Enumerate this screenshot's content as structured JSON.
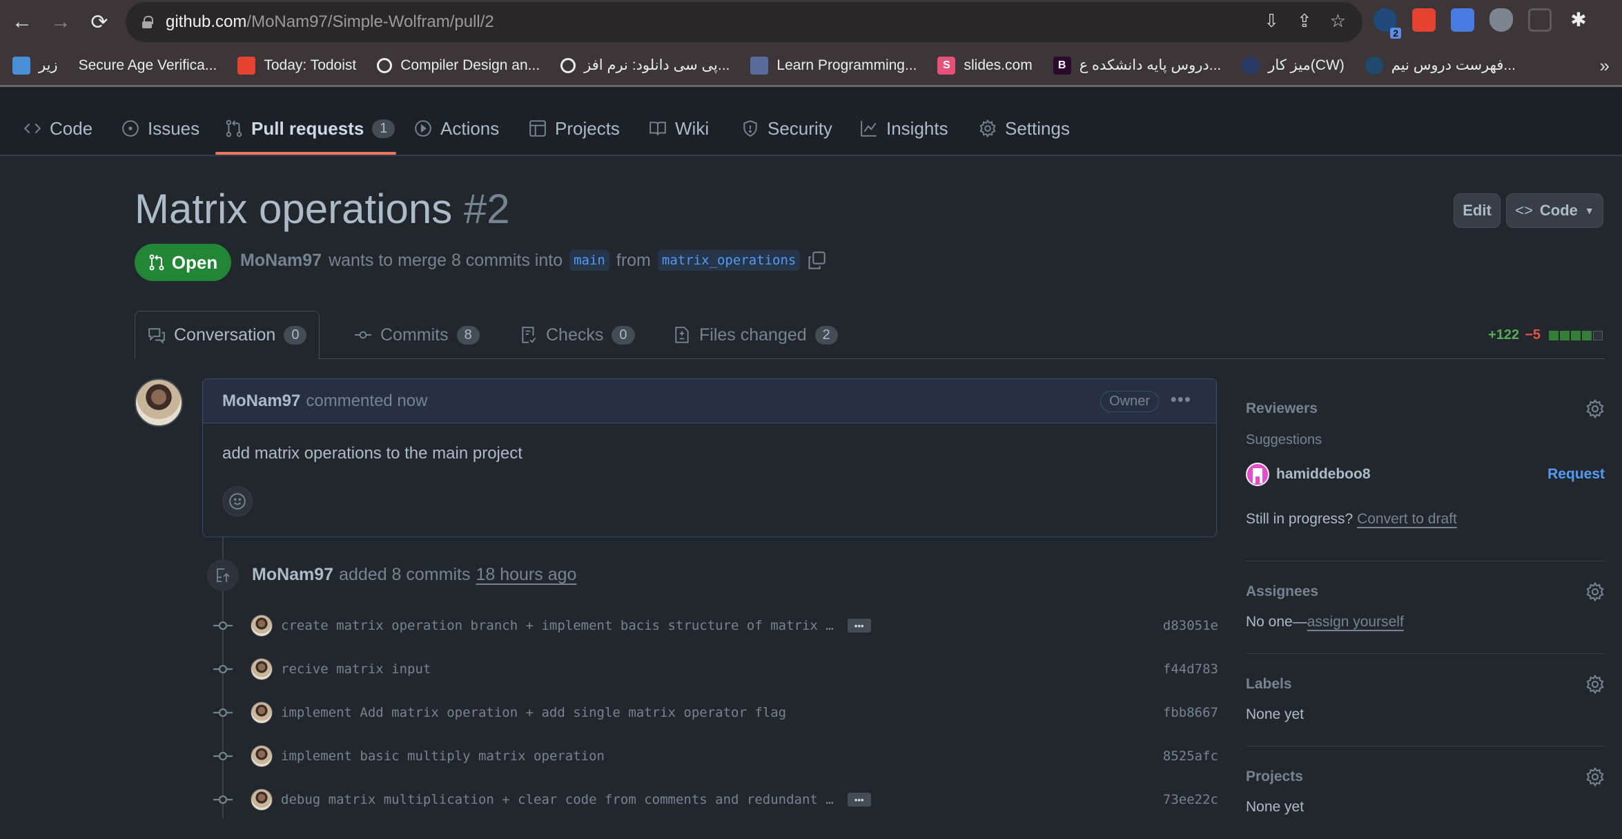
{
  "browser": {
    "url_host": "github.com",
    "url_path": "/MoNam97/Simple-Wolfram/pull/2",
    "extension_badge": "2",
    "bookmarks": [
      {
        "label": "زیر",
        "icon": "download-icon",
        "color": "#4a90d9"
      },
      {
        "label": "Secure Age Verifica...",
        "icon": "",
        "color": ""
      },
      {
        "label": "Today: Todoist",
        "icon": "todoist-icon",
        "color": "#e44332"
      },
      {
        "label": "Compiler Design an...",
        "icon": "globe-icon",
        "color": "#ececec"
      },
      {
        "label": "پی سی دانلود: نرم افز...",
        "icon": "globe-icon",
        "color": "#ececec"
      },
      {
        "label": "Learn Programming...",
        "icon": "learn-icon",
        "color": "#5a6a9a"
      },
      {
        "label": "slides.com",
        "icon": "slides-icon",
        "color": "#e4527a"
      },
      {
        "label": "دروس پایه دانشکده ع...",
        "icon": "b-icon",
        "color": "#2b0a2e"
      },
      {
        "label": "میز کار(CW)",
        "icon": "cw-icon",
        "color": "#2a3a66"
      },
      {
        "label": "فهرست دروس نیم...",
        "icon": "cw-icon",
        "color": "#1e4a6e"
      }
    ],
    "more_label": "»"
  },
  "repo_nav": {
    "tabs": [
      {
        "label": "Code",
        "icon": "code-icon"
      },
      {
        "label": "Issues",
        "icon": "issue-icon"
      },
      {
        "label": "Pull requests",
        "icon": "pull-request-icon",
        "count": "1",
        "active": true
      },
      {
        "label": "Actions",
        "icon": "play-icon"
      },
      {
        "label": "Projects",
        "icon": "table-icon"
      },
      {
        "label": "Wiki",
        "icon": "book-icon"
      },
      {
        "label": "Security",
        "icon": "shield-icon"
      },
      {
        "label": "Insights",
        "icon": "graph-icon"
      },
      {
        "label": "Settings",
        "icon": "gear-icon"
      }
    ]
  },
  "pr": {
    "title": "Matrix operations",
    "number": "#2",
    "edit_label": "Edit",
    "code_label": "Code",
    "state": "Open",
    "author": "MoNam97",
    "merge_text": "wants to merge 8 commits into",
    "base_branch": "main",
    "from_text": "from",
    "head_branch": "matrix_operations"
  },
  "pr_tabs": [
    {
      "label": "Conversation",
      "count": "0",
      "icon": "comment-icon",
      "active": true
    },
    {
      "label": "Commits",
      "count": "8",
      "icon": "commit-icon"
    },
    {
      "label": "Checks",
      "count": "0",
      "icon": "checklist-icon"
    },
    {
      "label": "Files changed",
      "count": "2",
      "icon": "file-diff-icon"
    }
  ],
  "diffstat": {
    "additions": "+122",
    "deletions": "−5",
    "blocks": [
      "add",
      "add",
      "add",
      "add",
      "neutral"
    ],
    "colors": {
      "add": "#347d39",
      "del": "#c93c37",
      "neutral": "#2d333b"
    }
  },
  "comment": {
    "author": "MoNam97",
    "action": "commented now",
    "badge": "Owner",
    "body": "add matrix operations to the main project"
  },
  "commit_event": {
    "author": "MoNam97",
    "text": "added 8 commits",
    "time": "18 hours ago"
  },
  "commits": [
    {
      "message": "create matrix operation branch + implement bacis structure of matrix …",
      "sha": "d83051e",
      "truncated": true
    },
    {
      "message": "recive matrix input",
      "sha": "f44d783",
      "truncated": false
    },
    {
      "message": "implement Add matrix operation + add single matrix operator flag",
      "sha": "fbb8667",
      "truncated": false
    },
    {
      "message": "implement basic multiply matrix operation",
      "sha": "8525afc",
      "truncated": false
    },
    {
      "message": "debug matrix multiplication + clear code from comments and redundant …",
      "sha": "73ee22c",
      "truncated": true
    }
  ],
  "sidebar": {
    "reviewers": {
      "title": "Reviewers",
      "suggestions_label": "Suggestions",
      "suggested_user": "hamiddeboo8",
      "request_label": "Request",
      "progress_text": "Still in progress?",
      "draft_link": "Convert to draft"
    },
    "assignees": {
      "title": "Assignees",
      "prefix": "No one—",
      "link": "assign yourself"
    },
    "labels": {
      "title": "Labels",
      "value": "None yet"
    },
    "projects": {
      "title": "Projects",
      "value": "None yet"
    }
  }
}
